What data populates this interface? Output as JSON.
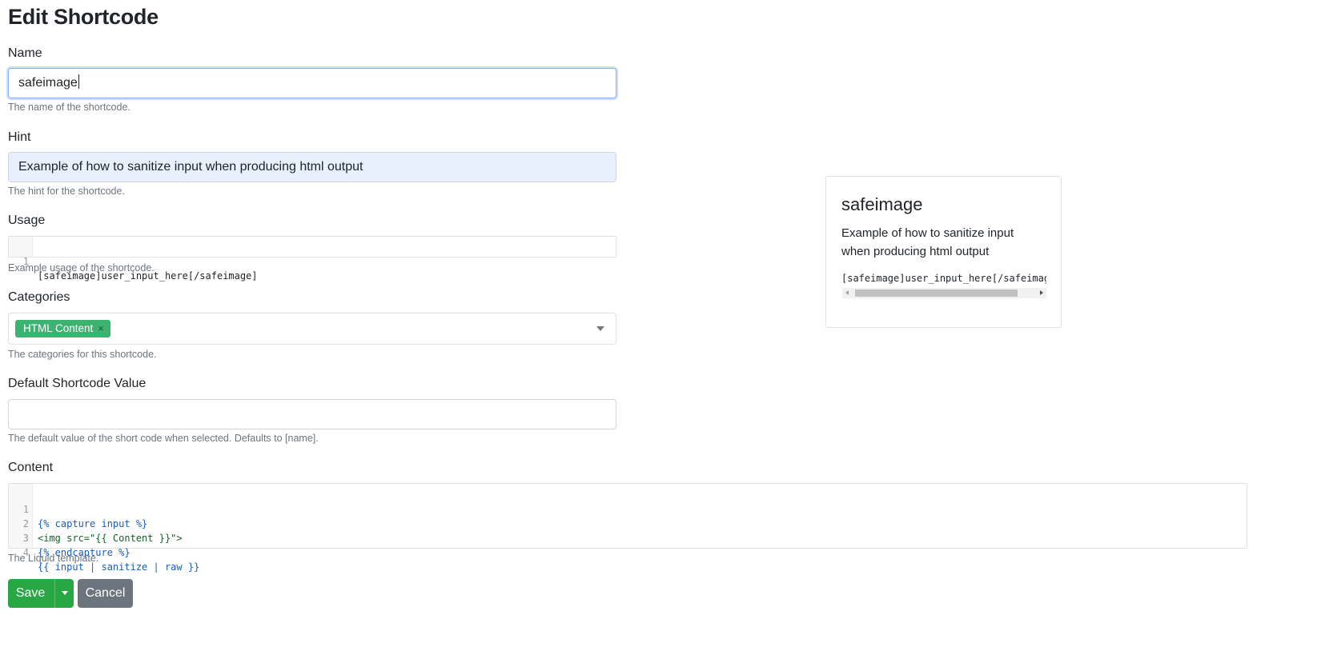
{
  "page": {
    "title": "Edit Shortcode"
  },
  "form": {
    "name": {
      "label": "Name",
      "value": "safeimage",
      "help": "The name of the shortcode."
    },
    "hint": {
      "label": "Hint",
      "value": "Example of how to sanitize input when producing html output",
      "help": "The hint for the shortcode."
    },
    "usage": {
      "label": "Usage",
      "lines": [
        {
          "no": "1",
          "text": "[safeimage]user_input_here[/safeimage]"
        }
      ],
      "help": "Example usage of the shortcode."
    },
    "categories": {
      "label": "Categories",
      "selected": [
        {
          "label": "HTML Content",
          "remove": "×"
        }
      ],
      "help": "The categories for this shortcode."
    },
    "default_value": {
      "label": "Default Shortcode Value",
      "value": "",
      "help": "The default value of the short code when selected. Defaults to [name]."
    },
    "content": {
      "label": "Content",
      "lines": [
        {
          "no": "1",
          "text": "{% capture input %}"
        },
        {
          "no": "2",
          "text": "<img src=\"{{ Content }}\">"
        },
        {
          "no": "3",
          "text": "{% endcapture %}"
        },
        {
          "no": "4",
          "text": "{{ input | sanitize | raw }}"
        }
      ],
      "help": "The Liquid template."
    }
  },
  "actions": {
    "save_label": "Save",
    "cancel_label": "Cancel"
  },
  "preview": {
    "title": "safeimage",
    "hint": "Example of how to sanitize input when producing html output",
    "usage": "[safeimage]user_input_here[/safeimage]"
  },
  "icons": {
    "chip_remove": "close-icon",
    "select_toggle": "chevron-down-icon",
    "save_dropdown": "caret-down-icon"
  },
  "colors": {
    "save": "#28a745",
    "cancel": "#6c757d",
    "chip": "#3cb371",
    "focus_border": "#86b7fe",
    "autofill_bg": "#e8f0fe"
  }
}
